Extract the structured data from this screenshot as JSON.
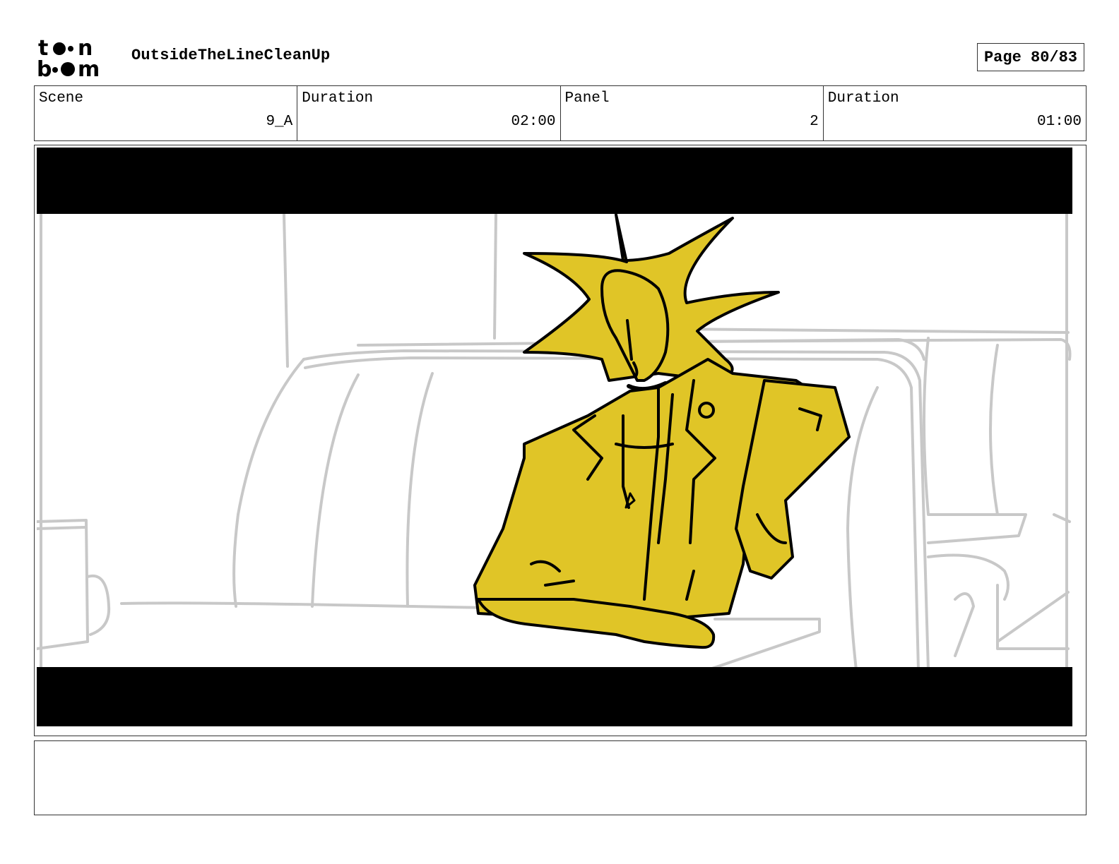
{
  "header": {
    "logo_text": "toon boom",
    "project_title": "OutsideTheLineCleanUp",
    "page_label": "Page 80/83"
  },
  "info": {
    "scene_label": "Scene",
    "scene_value": "9_A",
    "scene_duration_label": "Duration",
    "scene_duration_value": "02:00",
    "panel_label": "Panel",
    "panel_value": "2",
    "panel_duration_label": "Duration",
    "panel_duration_value": "01:00"
  },
  "notes": {
    "text": ""
  },
  "colors": {
    "character_fill": "#e0c527",
    "background_lines": "#c8c8c8",
    "letterbox": "#000000"
  }
}
